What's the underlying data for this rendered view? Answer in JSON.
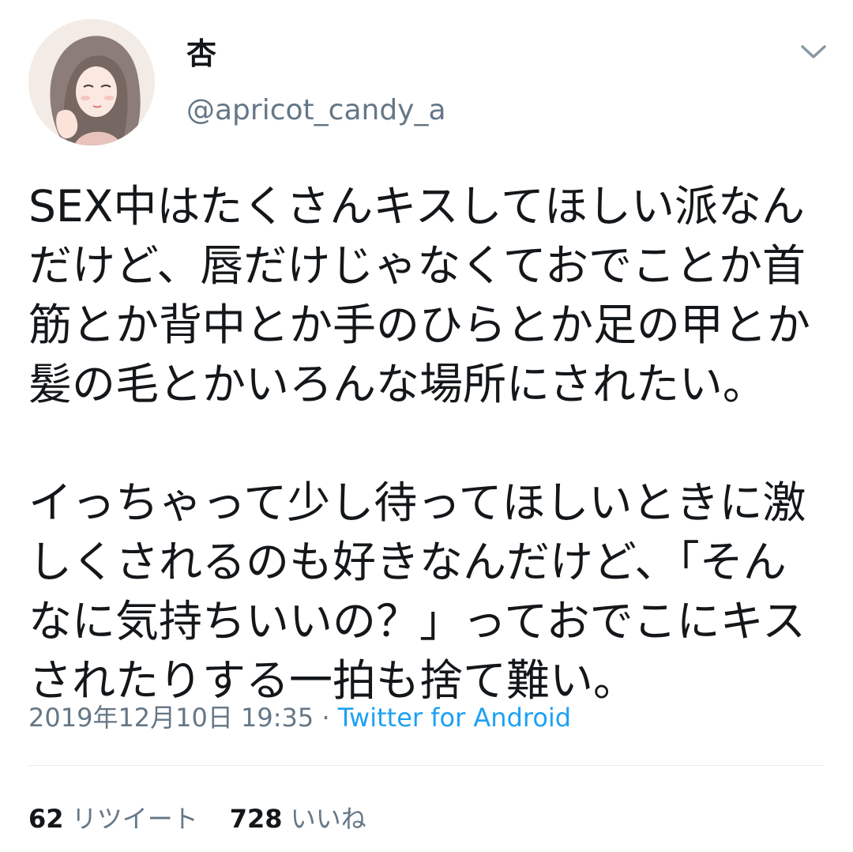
{
  "user": {
    "display_name": "杏",
    "handle": "@apricot_candy_a"
  },
  "tweet": {
    "text": "SEX中はたくさんキスしてほしい派なん\nだけど、唇だけじゃなくておでことか首\n筋とか背中とか手のひらとか足の甲とか\n髪の毛とかいろんな場所にされたい。\n\nイっちゃって少し待ってほしいときに激\nしくされるのも好きなんだけど、「そん\nなに気持ちいいの？」っておでこにキス\nされたりする一拍も捨て難い。",
    "timestamp": "2019年12月10日 19:35",
    "separator": " · ",
    "source": "Twitter for Android"
  },
  "stats": {
    "retweet_count": "62",
    "retweet_label": "リツイート",
    "like_count": "728",
    "like_label": "いいね"
  },
  "icons": {
    "caret": "chevron-down-icon",
    "avatar": "avatar-illustration"
  },
  "colors": {
    "text": "#14171a",
    "secondary": "#657786",
    "link": "#1da1f2",
    "divider": "#e6ecf0"
  }
}
